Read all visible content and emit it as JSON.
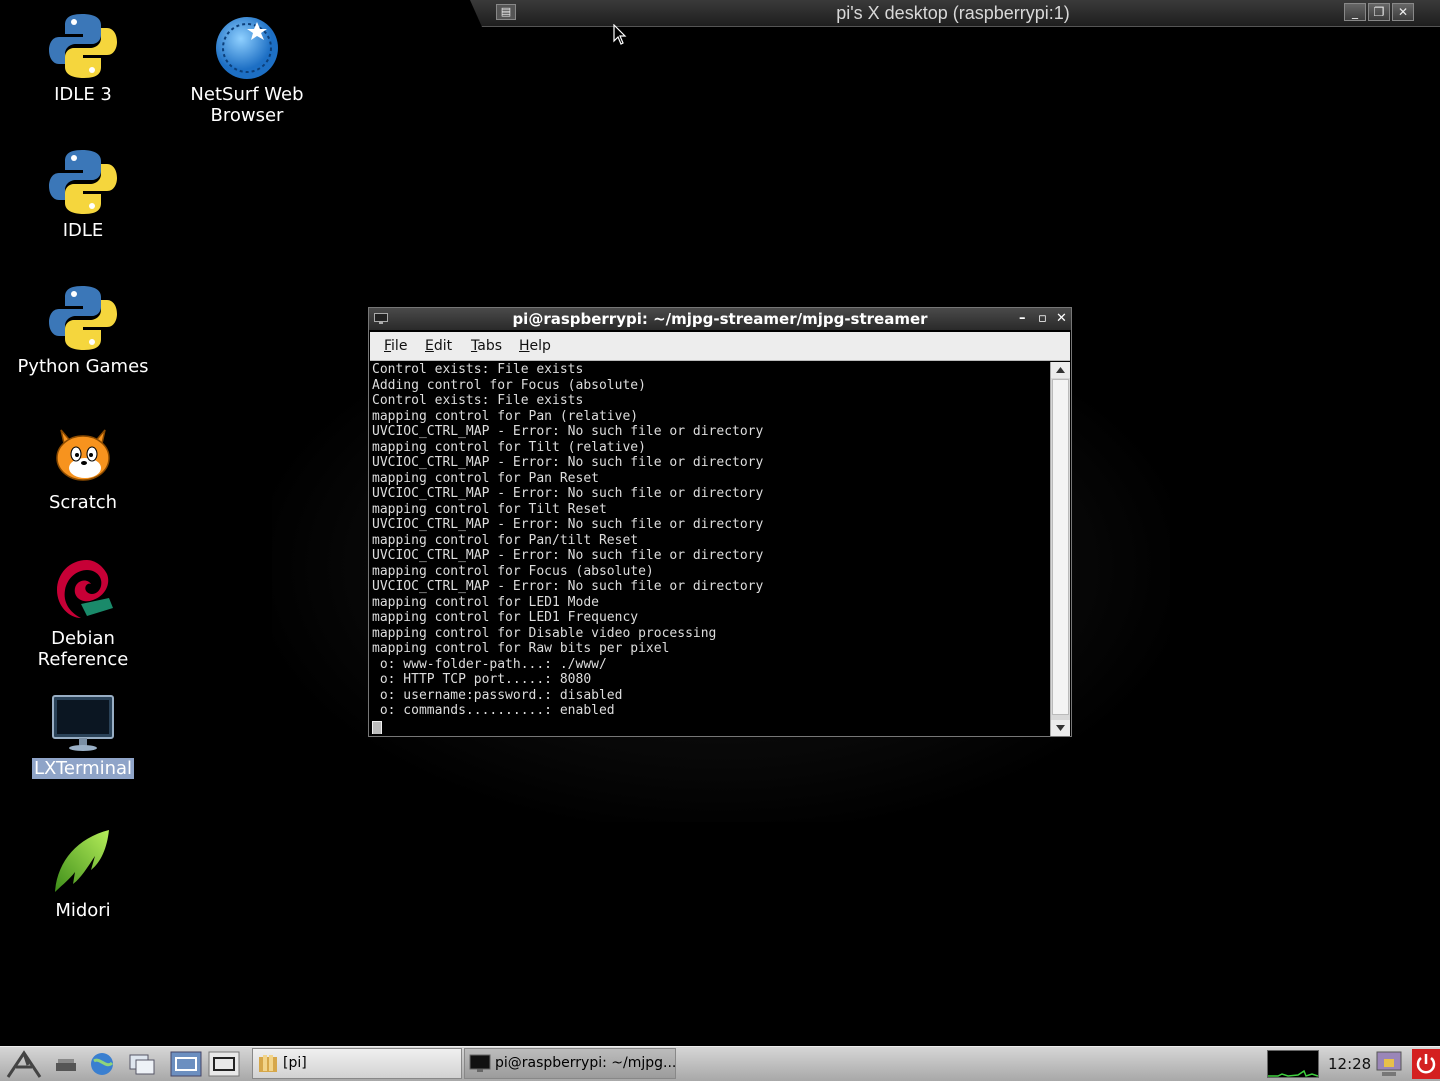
{
  "vnc": {
    "title": "pi's X desktop (raspberrypi:1)"
  },
  "desktop": {
    "icons": [
      {
        "label": "IDLE 3",
        "icon": "python-icon"
      },
      {
        "label": "NetSurf Web Browser",
        "icon": "netsurf-icon"
      },
      {
        "label": "IDLE",
        "icon": "python-icon"
      },
      {
        "label": "Python Games",
        "icon": "python-icon"
      },
      {
        "label": "Scratch",
        "icon": "scratch-cat-icon"
      },
      {
        "label": "Debian Reference",
        "icon": "debian-swirl-icon"
      },
      {
        "label": "LXTerminal",
        "icon": "monitor-icon",
        "selected": true
      },
      {
        "label": "Midori",
        "icon": "midori-leaf-icon"
      }
    ]
  },
  "terminal": {
    "title": "pi@raspberrypi: ~/mjpg-streamer/mjpg-streamer",
    "menu": [
      {
        "mnemonic": "F",
        "rest": "ile"
      },
      {
        "mnemonic": "E",
        "rest": "dit"
      },
      {
        "mnemonic": "T",
        "rest": "abs"
      },
      {
        "mnemonic": "H",
        "rest": "elp"
      }
    ],
    "lines": [
      "Control exists: File exists",
      "Adding control for Focus (absolute)",
      "Control exists: File exists",
      "mapping control for Pan (relative)",
      "UVCIOC_CTRL_MAP - Error: No such file or directory",
      "mapping control for Tilt (relative)",
      "UVCIOC_CTRL_MAP - Error: No such file or directory",
      "mapping control for Pan Reset",
      "UVCIOC_CTRL_MAP - Error: No such file or directory",
      "mapping control for Tilt Reset",
      "UVCIOC_CTRL_MAP - Error: No such file or directory",
      "mapping control for Pan/tilt Reset",
      "UVCIOC_CTRL_MAP - Error: No such file or directory",
      "mapping control for Focus (absolute)",
      "UVCIOC_CTRL_MAP - Error: No such file or directory",
      "mapping control for LED1 Mode",
      "mapping control for LED1 Frequency",
      "mapping control for Disable video processing",
      "mapping control for Raw bits per pixel",
      " o: www-folder-path...: ./www/",
      " o: HTTP TCP port.....: 8080",
      " o: username:password.: disabled",
      " o: commands..........: enabled"
    ]
  },
  "taskbar": {
    "tasks": [
      {
        "label": "[pi]",
        "icon": "folder-icon"
      },
      {
        "label": "pi@raspberrypi: ~/mjpg...",
        "icon": "terminal-icon"
      }
    ],
    "clock": "12:28"
  },
  "colors": {
    "desktop_bg": "#000000",
    "selection": "#8fa4c8",
    "python_blue": "#3b77b8",
    "python_yellow": "#f5d63d"
  }
}
